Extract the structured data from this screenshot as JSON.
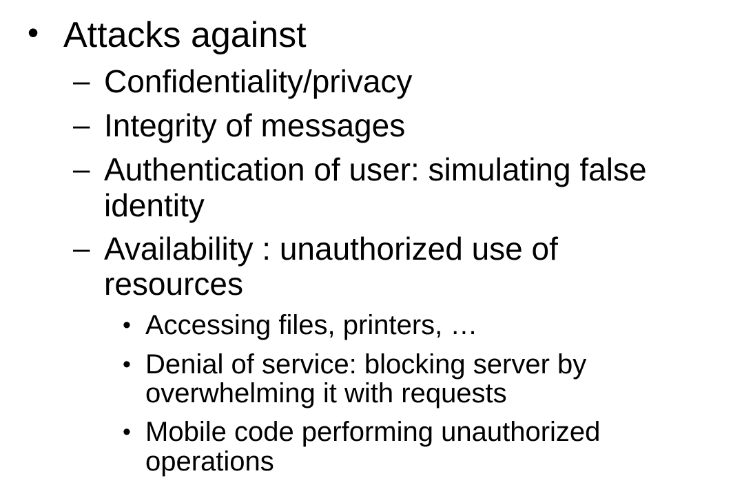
{
  "slide": {
    "title_bullet": "•",
    "title": "Attacks against",
    "items": [
      {
        "marker": "–",
        "lines": [
          "Confidentiality/privacy"
        ]
      },
      {
        "marker": "–",
        "lines": [
          "Integrity of messages"
        ]
      },
      {
        "marker": "–",
        "lines": [
          "Authentication of user: simulating false",
          "identity"
        ]
      },
      {
        "marker": "–",
        "lines": [
          "Availability : unauthorized use of",
          "resources"
        ],
        "subitems": [
          {
            "marker": "•",
            "lines": [
              "Accessing files, printers, …"
            ]
          },
          {
            "marker": "•",
            "lines": [
              "Denial of service: blocking server by",
              "overwhelming it with requests"
            ]
          },
          {
            "marker": "•",
            "lines": [
              "Mobile code performing unauthorized",
              "operations"
            ]
          }
        ]
      }
    ]
  }
}
